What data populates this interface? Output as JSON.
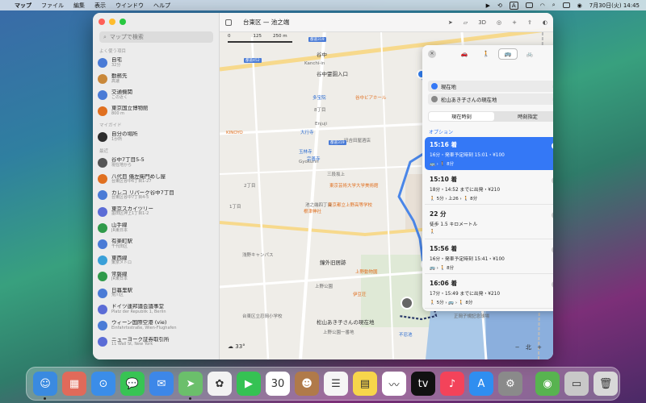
{
  "menubar": {
    "app_name": "マップ",
    "menus": [
      "ファイル",
      "編集",
      "表示",
      "ウインドウ",
      "ヘルプ"
    ],
    "input_indicator": "A",
    "datetime": "7月30日(火)  14:45"
  },
  "sidebar": {
    "search_placeholder": "マップで検索",
    "favorites_title": "よく使う項目",
    "favorites": [
      {
        "title": "自宅",
        "sub": "32分",
        "icon": "home-icon",
        "color": "#4a7bd6"
      },
      {
        "title": "勤務先",
        "sub": "高速",
        "icon": "briefcase-icon",
        "color": "#c9883a"
      },
      {
        "title": "交通機関",
        "sub": "この近く",
        "icon": "train-icon",
        "color": "#4a7bd6"
      },
      {
        "title": "東京国立博物館",
        "sub": "800 m",
        "icon": "museum-icon",
        "color": "#e07020"
      }
    ],
    "guides_title": "マイガイド",
    "guides": [
      {
        "title": "自分の場所",
        "sub": "1か所",
        "icon": "guide-icon",
        "color": "#2d2d2d"
      }
    ],
    "recents_title": "最近",
    "recents": [
      {
        "title": "谷中7丁目5-5",
        "sub": "現在地から",
        "icon": "directions-icon",
        "color": "#555555"
      },
      {
        "title": "八代目 儀左衛門めし屋",
        "sub": "台東区谷中6丁目1-27",
        "icon": "fork-icon",
        "color": "#e07020"
      },
      {
        "title": "カレコ リパーク谷中7丁目",
        "sub": "台東区谷中7丁目4-5",
        "icon": "parking-icon",
        "color": "#4a7bd6"
      },
      {
        "title": "東京スカイツリー",
        "sub": "墨田区押上1丁目1-2",
        "icon": "star-icon",
        "color": "#5b6cd6"
      },
      {
        "title": "山手線",
        "sub": "JR東日本",
        "icon": "jr-icon",
        "color": "#2f9a4a"
      },
      {
        "title": "有楽町駅",
        "sub": "千代田区",
        "icon": "train-icon",
        "color": "#4a7bd6"
      },
      {
        "title": "東西線",
        "sub": "東京メトロ",
        "icon": "metro-icon",
        "color": "#3aa0d8"
      },
      {
        "title": "常磐線",
        "sub": "JR東日本",
        "icon": "jr-icon",
        "color": "#2f9a4a"
      },
      {
        "title": "日暮里駅",
        "sub": "荒川区",
        "icon": "train-icon",
        "color": "#4a7bd6"
      },
      {
        "title": "ドイツ連邦議会議事堂",
        "sub": "Platz der Republik 1, Berlin",
        "icon": "star-icon",
        "color": "#5b6cd6"
      },
      {
        "title": "ウィーン国際空港 (vie)",
        "sub": "Einfahrtsstraße, Wien-Flughafen",
        "icon": "plane-icon",
        "color": "#4a7bd6"
      },
      {
        "title": "ニューヨーク証券取引所",
        "sub": "11 Wall St, New York",
        "icon": "star-icon",
        "color": "#5b6cd6"
      }
    ]
  },
  "map": {
    "title": "台東区 — 池之端",
    "toolbar_3d": "3D",
    "scale": [
      "0",
      "125",
      "250 m"
    ],
    "weather": "33°",
    "compass": "北",
    "labels": [
      {
        "text": "谷中",
        "style": "dark"
      },
      {
        "text": "Kanchi-in",
        "style": ""
      },
      {
        "text": "谷中霊園入口",
        "style": "dark"
      },
      {
        "text": "谷中ビアホール",
        "style": "orange"
      },
      {
        "text": "多宝院",
        "style": "blue"
      },
      {
        "text": "8丁目",
        "style": ""
      },
      {
        "text": "Enjuji",
        "style": ""
      },
      {
        "text": "大行寺",
        "style": "blue"
      },
      {
        "text": "旧吉田屋酒店",
        "style": ""
      },
      {
        "text": "玉林寺",
        "style": "blue"
      },
      {
        "text": "宗善寺",
        "style": "blue"
      },
      {
        "text": "Gyokurin",
        "style": ""
      },
      {
        "text": "三段坂上",
        "style": ""
      },
      {
        "text": "2丁目",
        "style": ""
      },
      {
        "text": "東京芸術大学大学美術館",
        "style": "orange"
      },
      {
        "text": "池之端四丁目",
        "style": ""
      },
      {
        "text": "東京都立上野高等学校",
        "style": "orange"
      },
      {
        "text": "根津神社",
        "style": "orange"
      },
      {
        "text": "浅野キャンパス",
        "style": ""
      },
      {
        "text": "1丁目",
        "style": ""
      },
      {
        "text": "鐘外旧居跡",
        "style": "dark"
      },
      {
        "text": "上野動物園",
        "style": "orange"
      },
      {
        "text": "上野公園",
        "style": ""
      },
      {
        "text": "伊豆荘",
        "style": "orange"
      },
      {
        "text": "台東区立忍岡小学校",
        "style": ""
      },
      {
        "text": "松山あき子さんの現在地",
        "style": "dark"
      },
      {
        "text": "上野公園一番地",
        "style": ""
      },
      {
        "text": "不忍池",
        "style": "blue"
      },
      {
        "text": "KINOYO",
        "style": "orange"
      },
      {
        "text": "正岡子規記念球場",
        "style": ""
      }
    ],
    "road_shields": [
      "都道452",
      "都道319",
      "都道319",
      "都道437"
    ]
  },
  "directions": {
    "close_label": "×",
    "modes": [
      "🚗",
      "🚶",
      "🚌",
      "🚲"
    ],
    "from": "現在地",
    "to": "松山あき子さんの現在地",
    "time_tabs": [
      "現在時刻",
      "時刻指定"
    ],
    "options_label": "オプション",
    "routes": [
      {
        "title": "15:16 着",
        "sub": "16分・発車予定時刻 15:01・¥100",
        "legs": "🚌 › 🚶 8分",
        "selected": true
      },
      {
        "title": "15:10 着",
        "sub": "18分・14:52 までに出発・¥210",
        "legs": "🚶 5分 › 上26 › 🚶 8分",
        "selected": false
      },
      {
        "title": "22 分",
        "sub": "徒歩 1.5 キロメートル",
        "legs": "🚶",
        "selected": false
      },
      {
        "title": "15:56 着",
        "sub": "16分・発車予定時刻 15:41・¥100",
        "legs": "🚌 › 🚶 8分",
        "selected": false
      },
      {
        "title": "16:06 着",
        "sub": "17分・15:49 までに出発・¥210",
        "legs": "🚶 5分 › 🚌 › 🚶 8分",
        "selected": false
      }
    ]
  },
  "dock": {
    "apps": [
      {
        "name": "finder-icon",
        "glyph": "☺",
        "color": "#3a8ae0"
      },
      {
        "name": "launchpad-icon",
        "glyph": "▦",
        "color": "#e06a5a"
      },
      {
        "name": "safari-icon",
        "glyph": "⊙",
        "color": "#3b8de8"
      },
      {
        "name": "messages-icon",
        "glyph": "💬",
        "color": "#38c454"
      },
      {
        "name": "mail-icon",
        "glyph": "✉",
        "color": "#3d87e8"
      },
      {
        "name": "maps-icon",
        "glyph": "➤",
        "color": "#6bbf6b"
      },
      {
        "name": "photos-icon",
        "glyph": "✿",
        "color": "#f2f2f2"
      },
      {
        "name": "facetime-icon",
        "glyph": "▶",
        "color": "#35c253"
      },
      {
        "name": "calendar-icon",
        "glyph": "30",
        "color": "#ffffff"
      },
      {
        "name": "contacts-icon",
        "glyph": "☻",
        "color": "#b07a4a"
      },
      {
        "name": "reminders-icon",
        "glyph": "☰",
        "color": "#f5f5f5"
      },
      {
        "name": "notes-icon",
        "glyph": "▤",
        "color": "#f7d54b"
      },
      {
        "name": "freeform-icon",
        "glyph": "〰",
        "color": "#ffffff"
      },
      {
        "name": "appletv-icon",
        "glyph": "tv",
        "color": "#111111"
      },
      {
        "name": "music-icon",
        "glyph": "♪",
        "color": "#f3435a"
      },
      {
        "name": "appstore-icon",
        "glyph": "A",
        "color": "#2f8ef0"
      },
      {
        "name": "settings-icon",
        "glyph": "⚙",
        "color": "#8a8a8a"
      },
      {
        "name": "findmy-icon",
        "glyph": "◉",
        "color": "#58b350"
      },
      {
        "name": "downloads-icon",
        "glyph": "▭",
        "color": "#c8c8c8"
      },
      {
        "name": "trash-icon",
        "glyph": "🗑",
        "color": "#d8d8d8"
      }
    ]
  }
}
